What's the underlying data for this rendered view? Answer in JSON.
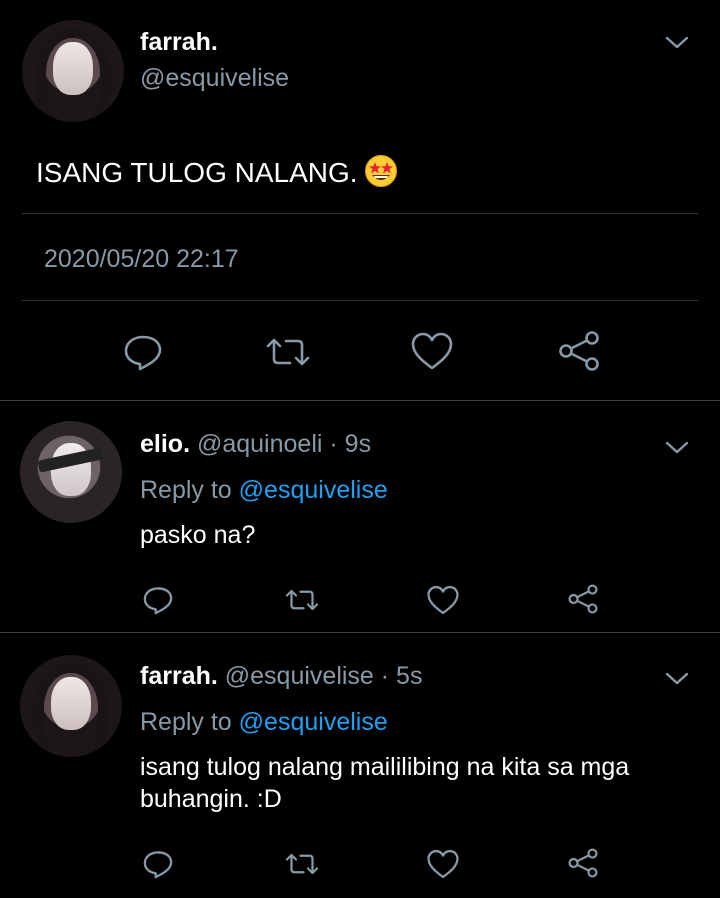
{
  "main_tweet": {
    "display_name": "farrah.",
    "handle": "@esquivelise",
    "text": "ISANG TULOG NALANG.",
    "emoji": "star-struck-emoji",
    "timestamp": "2020/05/20 22:17"
  },
  "replies": [
    {
      "display_name": "elio.",
      "handle": "@aquinoeli",
      "age": "· 9s",
      "replying_prefix": "Reply to",
      "replying_to": "@esquivelise",
      "text": "pasko na?"
    },
    {
      "display_name": "farrah.",
      "handle": "@esquivelise",
      "age": "· 5s",
      "replying_prefix": "Reply to",
      "replying_to": "@esquivelise",
      "text_line1": "isang tulog nalang maililibing na kita sa mga",
      "text_line2": "buhangin. :D"
    }
  ],
  "icons": {
    "reply": "speech-bubble-icon",
    "retweet": "retweet-icon",
    "like": "heart-icon",
    "share": "share-icon",
    "menu": "chevron-down-icon"
  },
  "colors": {
    "background": "#000000",
    "secondary_text": "#8899a6",
    "link": "#1da1f2",
    "divider": "#2f3336"
  }
}
